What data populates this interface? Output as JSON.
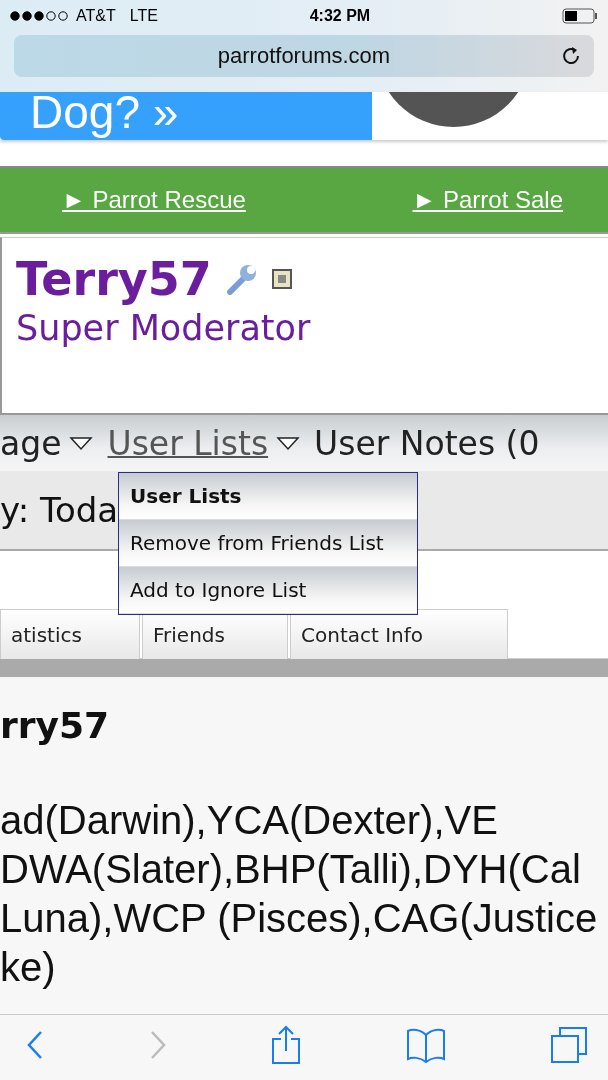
{
  "status_bar": {
    "carrier": "AT&T",
    "network": "LTE",
    "time": "4:32 PM"
  },
  "address_bar": {
    "url": "parrotforums.com"
  },
  "banner": {
    "text": "Dog? »"
  },
  "link_bar": {
    "links": [
      {
        "label": "► Parrot Rescue"
      },
      {
        "label": "► Parrot Sale"
      }
    ]
  },
  "profile": {
    "username": "Terry57",
    "title": "Super Moderator"
  },
  "nav": {
    "items": [
      {
        "label": "age",
        "dropdown": true,
        "selected": false
      },
      {
        "label": "User Lists",
        "dropdown": true,
        "selected": true
      },
      {
        "label": "User Notes (0",
        "dropdown": false,
        "selected": false
      }
    ]
  },
  "info_row": {
    "text": "y: Toda"
  },
  "dropdown_menu": {
    "items": [
      {
        "label": "User Lists",
        "kind": "header"
      },
      {
        "label": "Remove from Friends List",
        "kind": "item"
      },
      {
        "label": "Add to Ignore List",
        "kind": "item"
      }
    ]
  },
  "tabs": [
    {
      "label": "atistics",
      "selected": false
    },
    {
      "label": "Friends",
      "selected": false
    },
    {
      "label": "Contact Info",
      "selected": false
    }
  ],
  "content": {
    "heading": "rry57",
    "lines": [
      "ad(Darwin),YCA(Dexter),VE",
      "DWA(Slater),BHP(Talli),DYH(Cal",
      "Luna),WCP (Pisces),CAG(Justice",
      "ke)"
    ]
  },
  "toolbar": {
    "back_disabled": false,
    "forward_disabled": true
  }
}
